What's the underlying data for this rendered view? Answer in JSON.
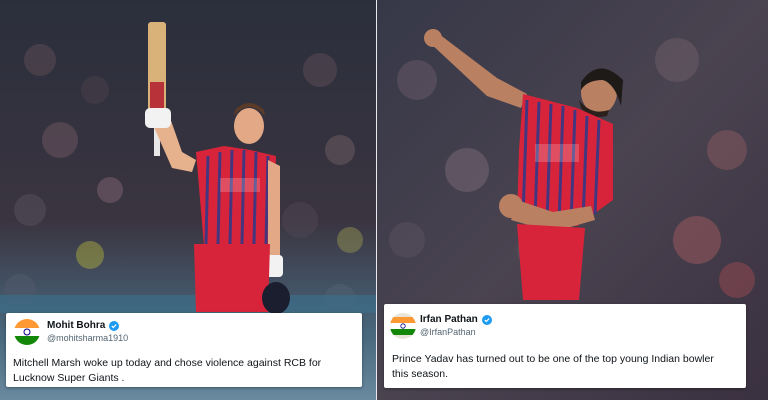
{
  "tweets": [
    {
      "name": "Mohit Bohra",
      "handle": "@mohitsharma1910",
      "text": "Mitchell Marsh woke up today and chose violence against RCB  for\nLucknow Super Giants  .",
      "avatar_icon": "india-flag-icon"
    },
    {
      "name": "Irfan Pathan",
      "handle": "@IrfanPathan",
      "text": "Prince Yadav has turned out to be one of the top young Indian bowler\nthis season.",
      "avatar_icon": "india-flag-icon"
    }
  ],
  "photos": [
    {
      "jersey_text": "JKsuper",
      "subject": "batter-celebrating-icon"
    },
    {
      "jersey_text": "JKsuper",
      "subject": "bowler-celebrating-icon"
    }
  ],
  "colors": {
    "jersey_red": "#d8243a",
    "jersey_blue": "#2a3a8c",
    "verified_blue": "#1d9bf0",
    "crowd_dark": "#2a2d38"
  }
}
